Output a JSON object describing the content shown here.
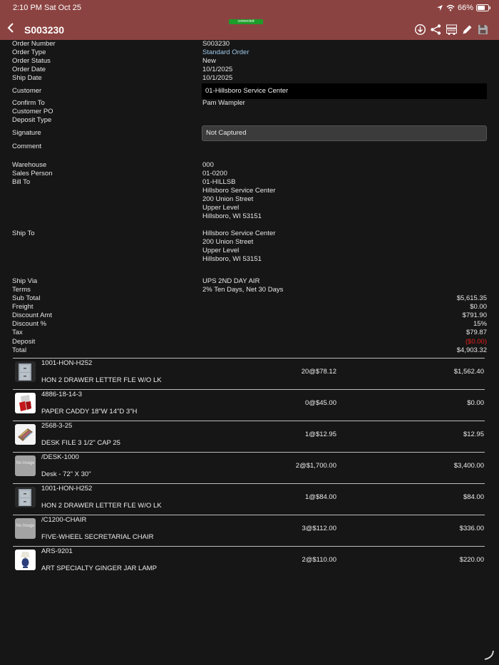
{
  "status_bar": {
    "time": "2:10 PM  Sat Oct 25",
    "battery": "66%"
  },
  "header": {
    "title": "S003230",
    "connection": "connected"
  },
  "icons": {
    "back": "chevron-left-icon",
    "toolbar": [
      "download-icon",
      "share-icon",
      "truck-icon",
      "pencil-icon",
      "save-icon"
    ]
  },
  "order": {
    "order_number_label": "Order Number",
    "order_number": "S003230",
    "order_type_label": "Order Type",
    "order_type": "Standard Order",
    "order_status_label": "Order Status",
    "order_status": "New",
    "order_date_label": "Order Date",
    "order_date": "10/1/2025",
    "ship_date_label": "Ship Date",
    "ship_date": "10/1/2025",
    "customer_label": "Customer",
    "customer": "01-Hillsboro Service Center",
    "confirm_to_label": "Confirm To",
    "confirm_to": "Pam Wampler",
    "customer_po_label": "Customer PO",
    "deposit_type_label": "Deposit Type",
    "signature_label": "Signature",
    "signature": "Not Captured",
    "comment_label": "Comment",
    "warehouse_label": "Warehouse",
    "warehouse": "000",
    "sales_person_label": "Sales Person",
    "sales_person": "01-0200",
    "bill_to_label": "Bill To",
    "bill_to": [
      "01-HILLSB",
      "Hillsboro Service Center",
      "200 Union Street",
      "Upper Level",
      "Hillsboro, WI 53151"
    ],
    "ship_to_label": "Ship To",
    "ship_to": [
      "Hillsboro Service Center",
      "200 Union Street",
      "Upper Level",
      "Hillsboro, WI 53151"
    ],
    "ship_via_label": "Ship Via",
    "ship_via": "UPS 2ND DAY AIR",
    "terms_label": "Terms",
    "terms": "2% Ten Days, Net 30 Days"
  },
  "totals": {
    "sub_total_label": "Sub Total",
    "sub_total": "$5,615.35",
    "freight_label": "Freight",
    "freight": "$0.00",
    "discount_amt_label": "Discount Amt",
    "discount_amt": "$791.90",
    "discount_pct_label": "Discount %",
    "discount_pct": "15%",
    "tax_label": "Tax",
    "tax": "$79.87",
    "deposit_label": "Deposit",
    "deposit": "($0.00)",
    "total_label": "Total",
    "total": "$4,903.32"
  },
  "colors": {
    "header": "#8b4341",
    "background": "#161616",
    "link": "#9cc7e8",
    "negative": "#e0201c",
    "connected": "#1e9c2a"
  },
  "lines": [
    {
      "code": "1001-HON-H252",
      "description": "HON 2 DRAWER LETTER FLE W/O LK",
      "qty": "20@$78.12",
      "extended": "$1,562.40",
      "image": "file-cabinet"
    },
    {
      "code": "4886-18-14-3",
      "description": "PAPER CADDY 18\"W 14\"D 3\"H",
      "qty": "0@$45.00",
      "extended": "$0.00",
      "image": "paper-caddy"
    },
    {
      "code": "2568-3-25",
      "description": "DESK FILE 3 1/2\" CAP 25",
      "qty": "1@$12.95",
      "extended": "$12.95",
      "image": "desk-file"
    },
    {
      "code": "/DESK-1000",
      "description": "Desk - 72\" X 30\"",
      "qty": "2@$1,700.00",
      "extended": "$3,400.00",
      "image": "none",
      "no_image_text": "No Image"
    },
    {
      "code": "1001-HON-H252",
      "description": "HON 2 DRAWER LETTER FLE W/O LK",
      "qty": "1@$84.00",
      "extended": "$84.00",
      "image": "file-cabinet"
    },
    {
      "code": "/C1200-CHAIR",
      "description": "FIVE-WHEEL SECRETARIAL CHAIR",
      "qty": "3@$112.00",
      "extended": "$336.00",
      "image": "none",
      "no_image_text": "No Image"
    },
    {
      "code": "ARS-9201",
      "description": "ART SPECIALTY GINGER JAR LAMP",
      "qty": "2@$110.00",
      "extended": "$220.00",
      "image": "lamp"
    }
  ]
}
